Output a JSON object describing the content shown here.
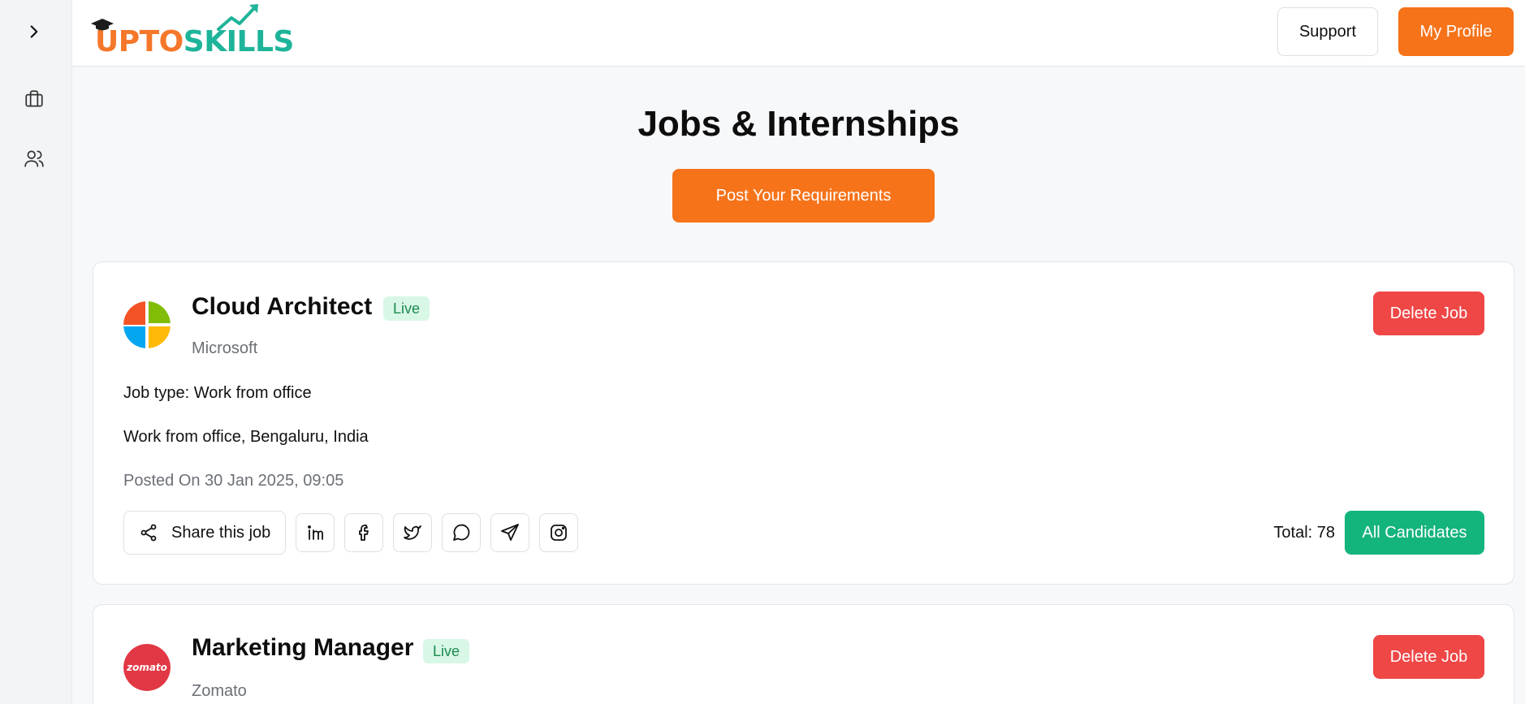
{
  "header": {
    "logo_part1": "UPTO",
    "logo_part2": "SKILLS",
    "support_label": "Support",
    "profile_label": "My Profile"
  },
  "sidebar": {
    "items": [
      {
        "icon": "chevron-right-icon"
      },
      {
        "icon": "briefcase-icon"
      },
      {
        "icon": "users-icon"
      }
    ]
  },
  "main": {
    "title": "Jobs & Internships",
    "post_label": "Post Your Requirements"
  },
  "jobs": [
    {
      "title": "Cloud Architect",
      "status": "Live",
      "company": "Microsoft",
      "job_type": "Job type: Work from office",
      "location": "Work from office, Bengaluru, India",
      "posted": "Posted On 30 Jan 2025, 09:05",
      "delete_label": "Delete Job",
      "share_label": "Share this job",
      "total": "Total: 78",
      "candidates_label": "All Candidates"
    },
    {
      "title": "Marketing Manager",
      "status": "Live",
      "company": "Zomato",
      "logo_text": "zomato",
      "delete_label": "Delete Job"
    }
  ],
  "colors": {
    "accent": "#f6731a",
    "danger": "#ef4646",
    "success": "#14b47d",
    "live_bg": "#d9f7e6",
    "live_text": "#1a8a4e"
  },
  "social_icons": [
    "linkedin-icon",
    "facebook-icon",
    "twitter-icon",
    "whatsapp-icon",
    "telegram-icon",
    "instagram-icon"
  ]
}
